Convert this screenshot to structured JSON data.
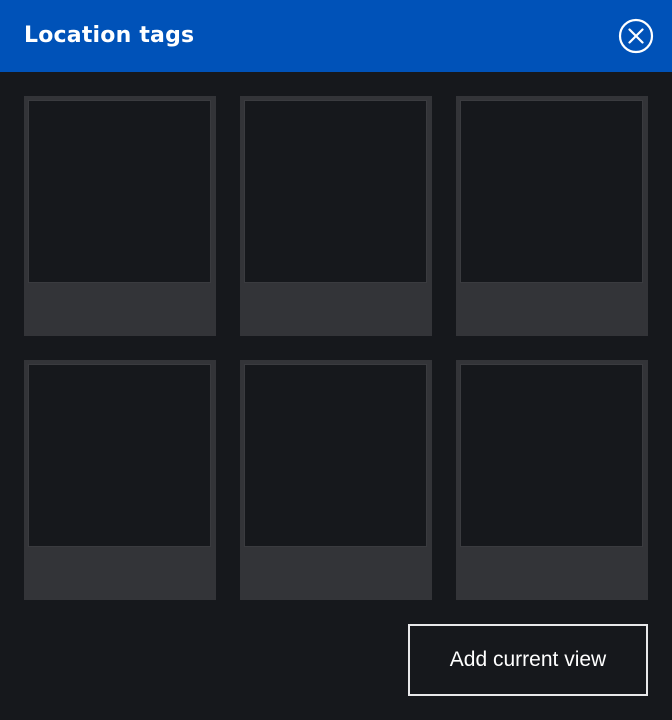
{
  "dialog": {
    "title": "Location tags",
    "close_icon": "close-circle-icon"
  },
  "tiles": [
    {
      "label": ""
    },
    {
      "label": ""
    },
    {
      "label": ""
    },
    {
      "label": ""
    },
    {
      "label": ""
    },
    {
      "label": ""
    }
  ],
  "actions": {
    "add_current_view_label": "Add current view"
  },
  "colors": {
    "header_bg": "#0052b8",
    "panel_bg": "#16181c",
    "tile_bg": "#333438",
    "text": "#ffffff"
  }
}
